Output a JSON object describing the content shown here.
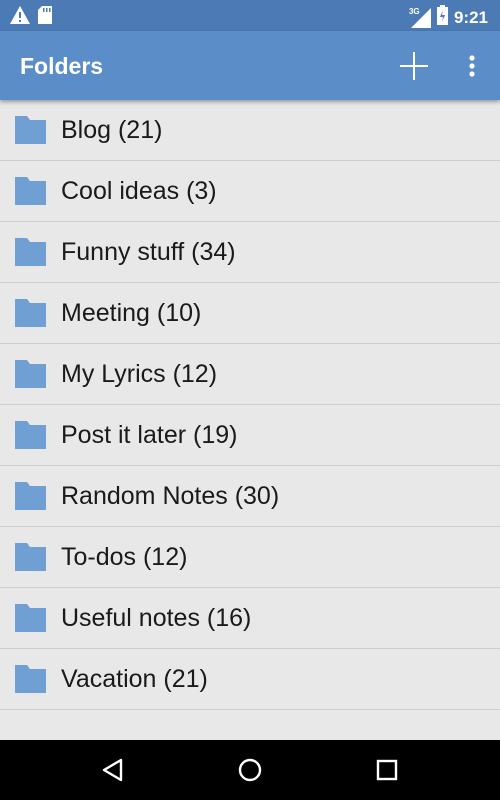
{
  "status_bar": {
    "icons": [
      "warning-icon",
      "sd-card-icon",
      "signal-icon",
      "battery-icon"
    ],
    "network_label": "3G",
    "time": "9:21"
  },
  "app_bar": {
    "title": "Folders",
    "actions": [
      "add-icon",
      "more-vert-icon"
    ]
  },
  "folders": [
    {
      "label": "Blog (21)"
    },
    {
      "label": "Cool ideas (3)"
    },
    {
      "label": "Funny stuff (34)"
    },
    {
      "label": "Meeting (10)"
    },
    {
      "label": "My Lyrics (12)"
    },
    {
      "label": "Post it later (19)"
    },
    {
      "label": "Random Notes (30)"
    },
    {
      "label": "To-dos (12)"
    },
    {
      "label": "Useful notes (16)"
    },
    {
      "label": "Vacation (21)"
    }
  ],
  "nav_bar": {
    "buttons": [
      "back-icon",
      "home-icon",
      "recents-icon"
    ]
  },
  "colors": {
    "status_bar": "#4b7ab4",
    "app_bar": "#5b8dc9",
    "list_background": "#e8e8e8",
    "folder_icon": "#6f9fd3",
    "divider": "#cfcfcf",
    "nav_bar": "#000000"
  }
}
